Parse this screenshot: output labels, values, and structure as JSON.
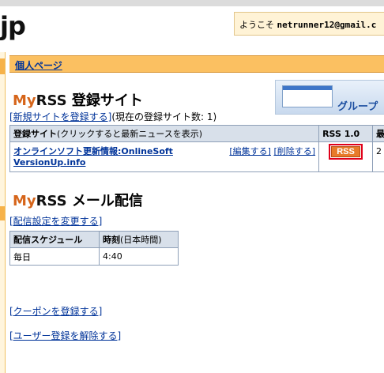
{
  "header": {
    "logo_suffix": "jp",
    "welcome_prefix": "ようこそ",
    "welcome_email": "netrunner12@gmail.c"
  },
  "nav": {
    "personal_page": "個人ページ"
  },
  "banner": {
    "label": "グループ"
  },
  "myrss_sites": {
    "title_my": "My",
    "title_rss": "RSS",
    "title_rest": " 登録サイト",
    "add_link": "[新規サイトを登録する]",
    "count_text": "(現在の登録サイト数: 1)",
    "table": {
      "col1_bold": "登録サイト",
      "col1_rest": "(クリックすると最新ニュースを表示)",
      "col2": "RSS 1.0",
      "col3": "最",
      "rows": [
        {
          "site_line1": "オンラインソフト更新情報:OnlineSoft",
          "site_line2": "VersionUp.info",
          "edit": "[編集する]",
          "delete": "[削除する]",
          "rss": "RSS",
          "last": "2"
        }
      ]
    }
  },
  "myrss_mail": {
    "title_my": "My",
    "title_rss": "RSS",
    "title_rest": " メール配信",
    "change_link": "[配信設定を変更する]",
    "table": {
      "col1": "配信スケジュール",
      "col2_bold": "時刻",
      "col2_rest": "(日本時間)",
      "rows": [
        {
          "schedule": "毎日",
          "time": "4:40"
        }
      ]
    }
  },
  "links": {
    "coupon": "[クーポンを登録する]",
    "unregister": "[ユーザー登録を解除する]"
  },
  "colors": {
    "nav_bar": "#fbc061",
    "welcome_bg": "#fff3d6",
    "link": "#003399",
    "rss_button": "#e87b2a",
    "rss_highlight": "#e0001a"
  }
}
